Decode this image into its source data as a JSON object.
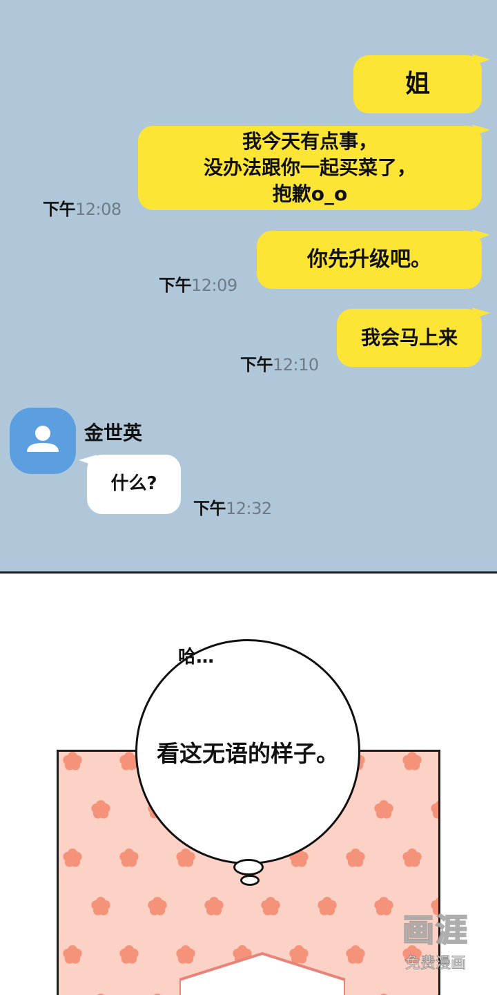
{
  "colors": {
    "chat_background": "#b0c6d9",
    "outgoing_bubble": "#fde535",
    "incoming_bubble": "#ffffff",
    "avatar": "#5b9fe0",
    "flower_background": "#fcd2c6",
    "flower": "#f4937a"
  },
  "chat": {
    "messages": [
      {
        "lines": [
          "姐"
        ]
      },
      {
        "lines": [
          "我今天有点事，",
          "没办法跟你一起买菜了，",
          "抱歉o_o"
        ],
        "ampm": "下午",
        "time": "12:08"
      },
      {
        "lines": [
          "你先升级吧。"
        ],
        "ampm": "下午",
        "time": "12:09"
      },
      {
        "lines": [
          "我会马上来"
        ],
        "ampm": "下午",
        "time": "12:10"
      }
    ],
    "incoming": {
      "sender": "金世英",
      "avatar_icon": "person-icon",
      "text": "什么?",
      "ampm": "下午",
      "time": "12:32"
    }
  },
  "panel2": {
    "sigh": "哈…",
    "thought": "看这无语的样子。"
  },
  "watermark": {
    "logo": "画涯",
    "sub": "免费漫画"
  }
}
